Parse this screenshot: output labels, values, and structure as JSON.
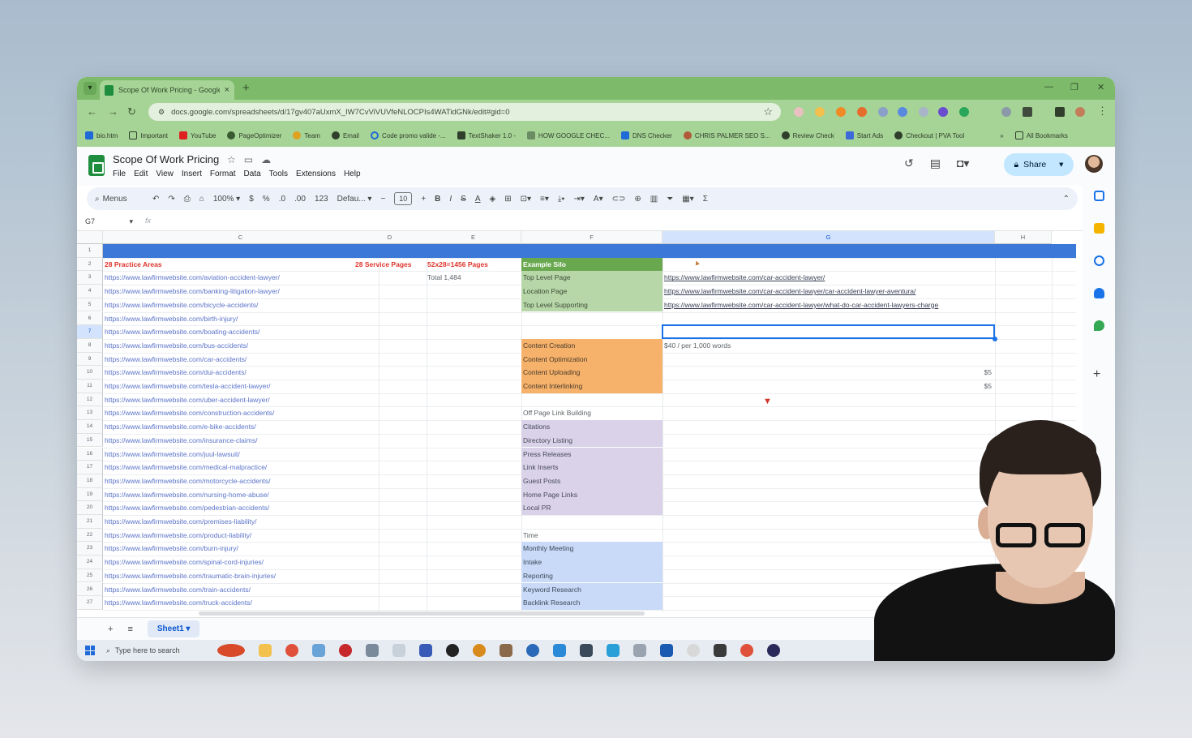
{
  "browser": {
    "tab_title": "Scope Of Work Pricing - Google",
    "url": "docs.google.com/spreadsheets/d/17gv407aUxmX_IW7CvViVUVfeNLOCPIs4WATidGNk/edit#gid=0",
    "bookmarks": [
      "bio.htm",
      "Important",
      "YouTube",
      "PageOptimizer",
      "Team",
      "Email",
      "Code promo valide -...",
      "TextShaker 1.0 -",
      "HOW GOOGLE CHEC...",
      "DNS Checker",
      "CHRIS PALMER SEO S...",
      "Review Check",
      "Start Ads",
      "Checkout | PVA Tool"
    ],
    "all_bookmarks": "All Bookmarks"
  },
  "sheets": {
    "doc_title": "Scope Of Work Pricing",
    "menus": [
      "File",
      "Edit",
      "View",
      "Insert",
      "Format",
      "Data",
      "Tools",
      "Extensions",
      "Help"
    ],
    "share_label": "Share",
    "toolbar": {
      "search": "Menus",
      "zoom": "100%",
      "currency": "$",
      "percent": "%",
      "dec_dec": ".0",
      "dec_inc": ".00",
      "num_format": "123",
      "font": "Defau...",
      "font_size": "10"
    },
    "namebox": "G7",
    "fx": "fx",
    "columns": [
      "C",
      "D",
      "E",
      "F",
      "G",
      "H"
    ],
    "rows": [
      "1",
      "2",
      "3",
      "4",
      "5",
      "6",
      "7",
      "8",
      "9",
      "10",
      "11",
      "12",
      "13",
      "14",
      "15",
      "16",
      "17",
      "18",
      "19",
      "20",
      "21",
      "22",
      "23",
      "24",
      "25",
      "26",
      "27"
    ],
    "col_c": [
      "28 Practice Areas",
      "https://www.lawfirmwebsite.com/aviation-accident-lawyer/",
      "https://www.lawfirmwebsite.com/banking-litigation-lawyer/",
      "https://www.lawfirmwebsite.com/bicycle-accidents/",
      "https://www.lawfirmwebsite.com/birth-injury/",
      "https://www.lawfirmwebsite.com/boating-accidents/",
      "https://www.lawfirmwebsite.com/bus-accidents/",
      "https://www.lawfirmwebsite.com/car-accidents/",
      "https://www.lawfirmwebsite.com/dui-accidents/",
      "https://www.lawfirmwebsite.com/tesla-accident-lawyer/",
      "https://www.lawfirmwebsite.com/uber-accident-lawyer/",
      "https://www.lawfirmwebsite.com/construction-accidents/",
      "https://www.lawfirmwebsite.com/e-bike-accidents/",
      "https://www.lawfirmwebsite.com/insurance-claims/",
      "https://www.lawfirmwebsite.com/juul-lawsuit/",
      "https://www.lawfirmwebsite.com/medical-malpractice/",
      "https://www.lawfirmwebsite.com/motorcycle-accidents/",
      "https://www.lawfirmwebsite.com/nursing-home-abuse/",
      "https://www.lawfirmwebsite.com/pedestrian-accidents/",
      "https://www.lawfirmwebsite.com/premises-liability/",
      "https://www.lawfirmwebsite.com/product-liability/",
      "https://www.lawfirmwebsite.com/burn-injury/",
      "https://www.lawfirmwebsite.com/spinal-cord-injuries/",
      "https://www.lawfirmwebsite.com/traumatic-brain-injuries/",
      "https://www.lawfirmwebsite.com/train-accidents/",
      "https://www.lawfirmwebsite.com/truck-accidents/"
    ],
    "d2": "28 Service Pages",
    "e2": "52x28=1456 Pages",
    "e3": "Total  1,484",
    "f_green": [
      "Example Silo",
      "Top Level Page",
      "Location Page",
      "Top Level Supporting"
    ],
    "g_links": [
      "https://www.lawfirmwebsite.com/car-accident-lawyer/",
      "https://www.lawfirmwebsite.com/car-accident-lawyer/car-accident-lawyer-aventura/",
      "https://www.lawfirmwebsite.com/car-accident-lawyer/what-do-car-accident-lawyers-charge"
    ],
    "f_orange": [
      "Content Creation",
      "Content Optimization",
      "Content Uploading",
      "Content Interlinking"
    ],
    "g8": "$40 / per 1,000 words",
    "g10": "$5",
    "g11": "$5",
    "f13": "Off Page Link Building",
    "f_purple": [
      "Citations",
      "Directory Listing",
      "Press Releases",
      "Link Inserts",
      "Guest Posts",
      "Home Page Links",
      "Local PR"
    ],
    "f22": "Time",
    "f_blue": [
      "Monthly Meeting",
      "Intake",
      "Reporting",
      "Keyword Research",
      "Backlink Research"
    ],
    "sheet_tab": "Sheet1"
  },
  "taskbar": {
    "search_placeholder": "Type here to search"
  },
  "colors": {
    "chrome_green": "#7dbb6b",
    "header_blue": "#3c78d8",
    "green_cells": "#b7d7a8",
    "orange_cells": "#f6b26b",
    "purple_cells": "#d9d2e9",
    "blue_cells": "#c9daf8",
    "silo_header": "#6aa84f"
  }
}
